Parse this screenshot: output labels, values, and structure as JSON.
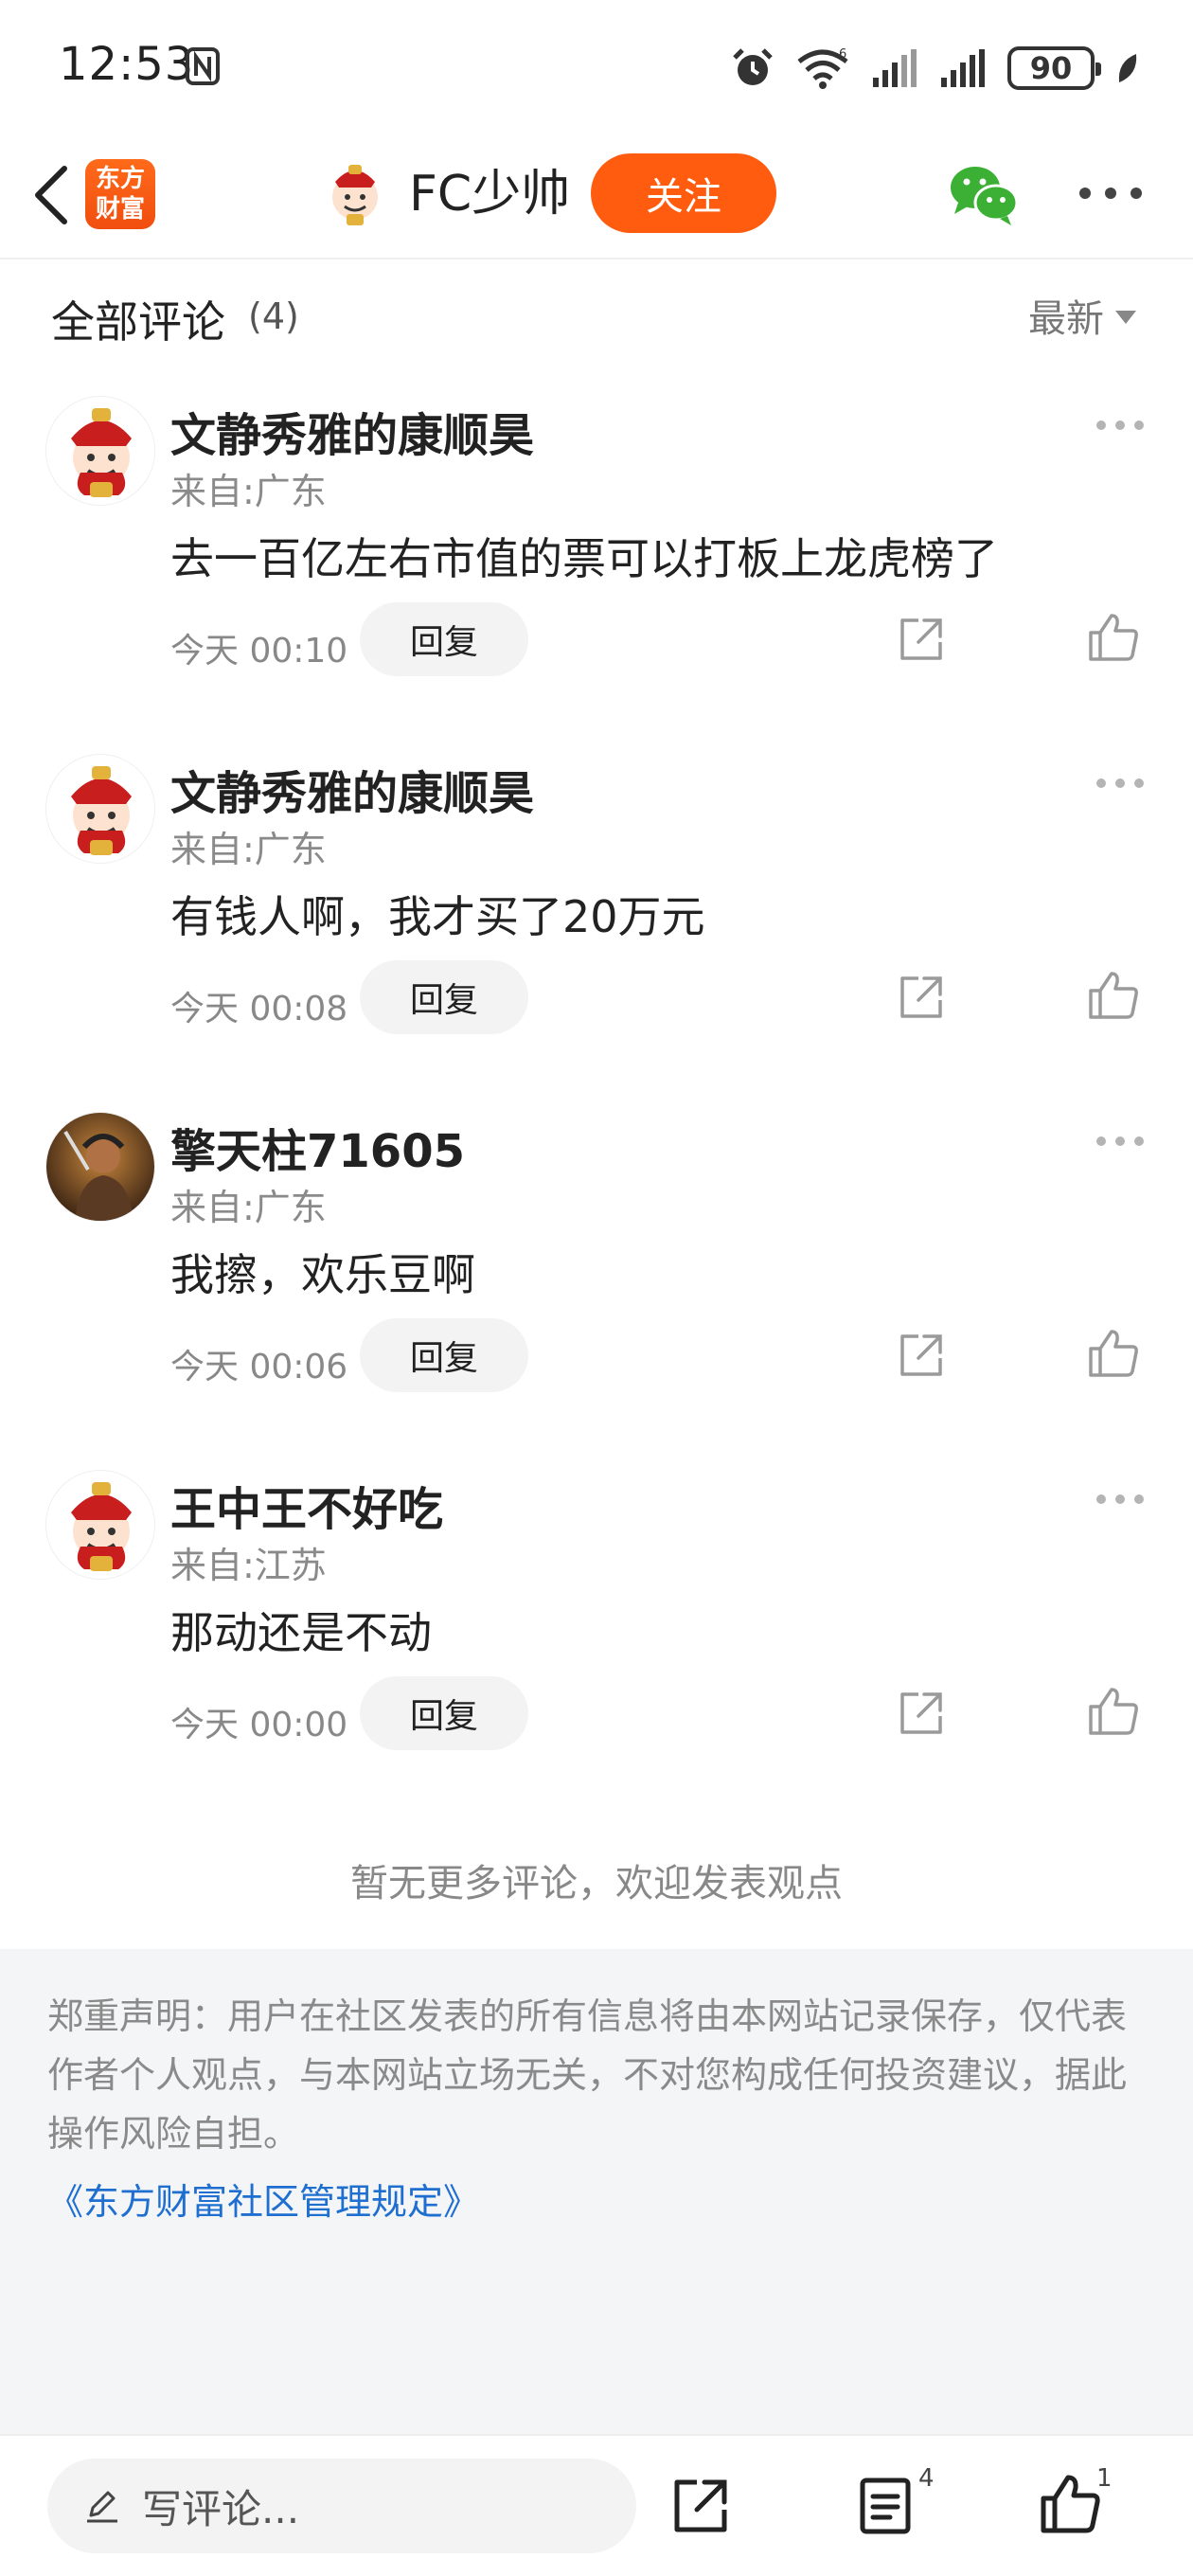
{
  "status_bar": {
    "time": "12:53",
    "battery": "90",
    "wifi_badge": "6"
  },
  "header": {
    "app_logo_text": "东方财富",
    "author_name": "FC少帅",
    "follow_label": "关注",
    "accent_color": "#ff5c0f"
  },
  "comments_section": {
    "title": "全部评论",
    "count": "(4)",
    "sort_label": "最新",
    "comments": [
      {
        "name": "文静秀雅的康顺昊",
        "location": "来自:广东",
        "text": "去一百亿左右市值的票可以打板上龙虎榜了",
        "time": "今天 00:10",
        "reply_label": "回复",
        "avatar": "caishen-avatar"
      },
      {
        "name": "文静秀雅的康顺昊",
        "location": "来自:广东",
        "text": "有钱人啊，我才买了20万元",
        "time": "今天 00:08",
        "reply_label": "回复",
        "avatar": "caishen-avatar"
      },
      {
        "name": "擎天柱71605",
        "location": "来自:广东",
        "text": "我擦，欢乐豆啊",
        "time": "今天 00:06",
        "reply_label": "回复",
        "avatar": "warrior-avatar"
      },
      {
        "name": "王中王不好吃",
        "location": "来自:江苏",
        "text": "那动还是不动",
        "time": "今天 00:00",
        "reply_label": "回复",
        "avatar": "caishen-avatar"
      }
    ],
    "no_more_text": "暂无更多评论，欢迎发表观点"
  },
  "disclaimer": {
    "text": "郑重声明：用户在社区发表的所有信息将由本网站记录保存，仅代表作者个人观点，与本网站立场无关，不对您构成任何投资建议，据此操作风险自担。",
    "link": "《东方财富社区管理规定》",
    "link_color": "#1f6fd0"
  },
  "bottom_bar": {
    "input_placeholder": "写评论...",
    "comment_count": "4",
    "like_count": "1"
  }
}
